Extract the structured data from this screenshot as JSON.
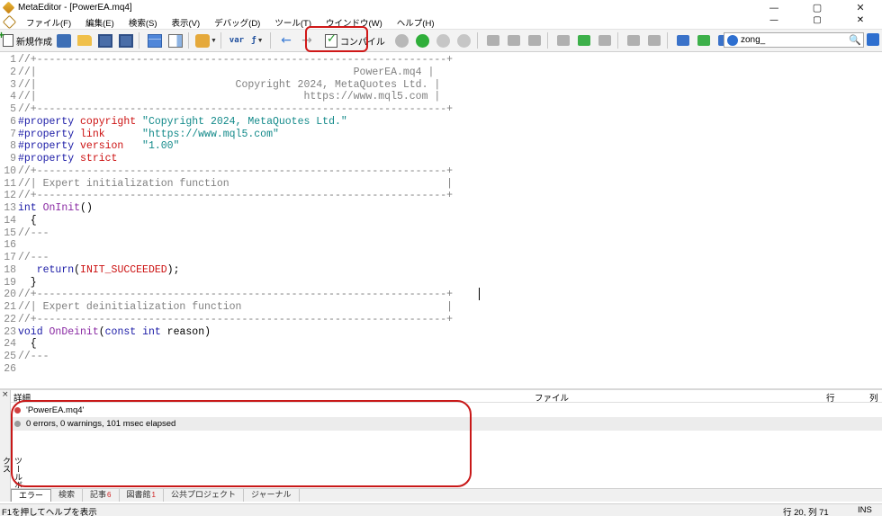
{
  "window": {
    "title": "MetaEditor - [PowerEA.mq4]",
    "controls": [
      "—",
      "▢",
      "✕"
    ]
  },
  "menu": {
    "items": [
      "ファイル(F)",
      "編集(E)",
      "検索(S)",
      "表示(V)",
      "デバッグ(D)",
      "ツール(T)",
      "ウインドウ(W)",
      "ヘルプ(H)"
    ],
    "right_controls": [
      "—",
      "▢",
      "✕"
    ]
  },
  "toolbar": {
    "new_label": "新規作成",
    "var_label": "var",
    "compile_label": "コンパイル",
    "search_value": "zong_"
  },
  "editor": {
    "lines": [
      {
        "n": "1",
        "parts": [
          {
            "t": "//+------------------------------------------------------------------+",
            "c": "comment"
          }
        ]
      },
      {
        "n": "2",
        "parts": [
          {
            "t": "//|                                                   PowerEA.mq4 |",
            "c": "comment"
          }
        ]
      },
      {
        "n": "3",
        "parts": [
          {
            "t": "//|                                Copyright 2024, MetaQuotes Ltd. |",
            "c": "comment"
          }
        ]
      },
      {
        "n": "4",
        "parts": [
          {
            "t": "//|                                           https://www.mql5.com |",
            "c": "comment"
          }
        ]
      },
      {
        "n": "5",
        "parts": [
          {
            "t": "//+------------------------------------------------------------------+",
            "c": "comment"
          }
        ]
      },
      {
        "n": "6",
        "parts": [
          {
            "t": "#property ",
            "c": "prop"
          },
          {
            "t": "copyright",
            "c": "propname"
          },
          {
            "t": " ",
            "c": ""
          },
          {
            "t": "\"Copyright 2024, MetaQuotes Ltd.\"",
            "c": "str"
          }
        ]
      },
      {
        "n": "7",
        "parts": [
          {
            "t": "#property ",
            "c": "prop"
          },
          {
            "t": "link",
            "c": "propname"
          },
          {
            "t": "      ",
            "c": ""
          },
          {
            "t": "\"https://www.mql5.com\"",
            "c": "str"
          }
        ]
      },
      {
        "n": "8",
        "parts": [
          {
            "t": "#property ",
            "c": "prop"
          },
          {
            "t": "version",
            "c": "propname"
          },
          {
            "t": "   ",
            "c": ""
          },
          {
            "t": "\"1.00\"",
            "c": "str"
          }
        ]
      },
      {
        "n": "9",
        "parts": [
          {
            "t": "#property ",
            "c": "prop"
          },
          {
            "t": "strict",
            "c": "propname"
          }
        ]
      },
      {
        "n": "10",
        "parts": [
          {
            "t": "//+------------------------------------------------------------------+",
            "c": "comment"
          }
        ]
      },
      {
        "n": "11",
        "parts": [
          {
            "t": "//| Expert initialization function                                   |",
            "c": "comment"
          }
        ]
      },
      {
        "n": "12",
        "parts": [
          {
            "t": "//+------------------------------------------------------------------+",
            "c": "comment"
          }
        ]
      },
      {
        "n": "13",
        "parts": [
          {
            "t": "int",
            "c": "kw"
          },
          {
            "t": " ",
            "c": ""
          },
          {
            "t": "OnInit",
            "c": "fn"
          },
          {
            "t": "()",
            "c": ""
          }
        ]
      },
      {
        "n": "14",
        "parts": [
          {
            "t": "  {",
            "c": ""
          }
        ]
      },
      {
        "n": "15",
        "parts": [
          {
            "t": "//---",
            "c": "comment"
          }
        ]
      },
      {
        "n": "16",
        "parts": [
          {
            "t": "",
            "c": ""
          }
        ]
      },
      {
        "n": "17",
        "parts": [
          {
            "t": "//---",
            "c": "comment"
          }
        ]
      },
      {
        "n": "18",
        "parts": [
          {
            "t": "   ",
            "c": ""
          },
          {
            "t": "return",
            "c": "kw"
          },
          {
            "t": "(",
            "c": ""
          },
          {
            "t": "INIT_SUCCEEDED",
            "c": "const"
          },
          {
            "t": ");",
            "c": ""
          }
        ]
      },
      {
        "n": "19",
        "parts": [
          {
            "t": "  }",
            "c": ""
          }
        ]
      },
      {
        "n": "20",
        "parts": [
          {
            "t": "//+------------------------------------------------------------------+",
            "c": "comment"
          }
        ]
      },
      {
        "n": "21",
        "parts": [
          {
            "t": "//| Expert deinitialization function                                 |",
            "c": "comment"
          }
        ]
      },
      {
        "n": "22",
        "parts": [
          {
            "t": "//+------------------------------------------------------------------+",
            "c": "comment"
          }
        ]
      },
      {
        "n": "23",
        "parts": [
          {
            "t": "void",
            "c": "kw"
          },
          {
            "t": " ",
            "c": ""
          },
          {
            "t": "OnDeinit",
            "c": "fn"
          },
          {
            "t": "(",
            "c": ""
          },
          {
            "t": "const",
            "c": "kw"
          },
          {
            "t": " ",
            "c": ""
          },
          {
            "t": "int",
            "c": "kw"
          },
          {
            "t": " reason)",
            "c": ""
          }
        ]
      },
      {
        "n": "24",
        "parts": [
          {
            "t": "  {",
            "c": ""
          }
        ]
      },
      {
        "n": "25",
        "parts": [
          {
            "t": "//---",
            "c": "comment"
          }
        ]
      },
      {
        "n": "26",
        "parts": [
          {
            "t": "",
            "c": ""
          }
        ]
      }
    ]
  },
  "toolbox": {
    "close_glyph": "×",
    "vertical_label": "ツールボックス",
    "columns": {
      "details": "詳細",
      "file": "ファイル",
      "line": "行",
      "col": "列"
    },
    "messages": [
      {
        "text": "'PowerEA.mq4'",
        "status": "error-icon"
      },
      {
        "text": "0 errors, 0 warnings, 101 msec elapsed",
        "status": "info-icon"
      }
    ],
    "tabs": [
      {
        "label": "エラー",
        "count": ""
      },
      {
        "label": "検索",
        "count": ""
      },
      {
        "label": "記事",
        "count": "6"
      },
      {
        "label": "図書館",
        "count": "1"
      },
      {
        "label": "公共プロジェクト",
        "count": ""
      },
      {
        "label": "ジャーナル",
        "count": ""
      }
    ]
  },
  "status": {
    "help": "F1を押してヘルプを表示",
    "position": "行 20, 列 71",
    "mode": "INS"
  }
}
